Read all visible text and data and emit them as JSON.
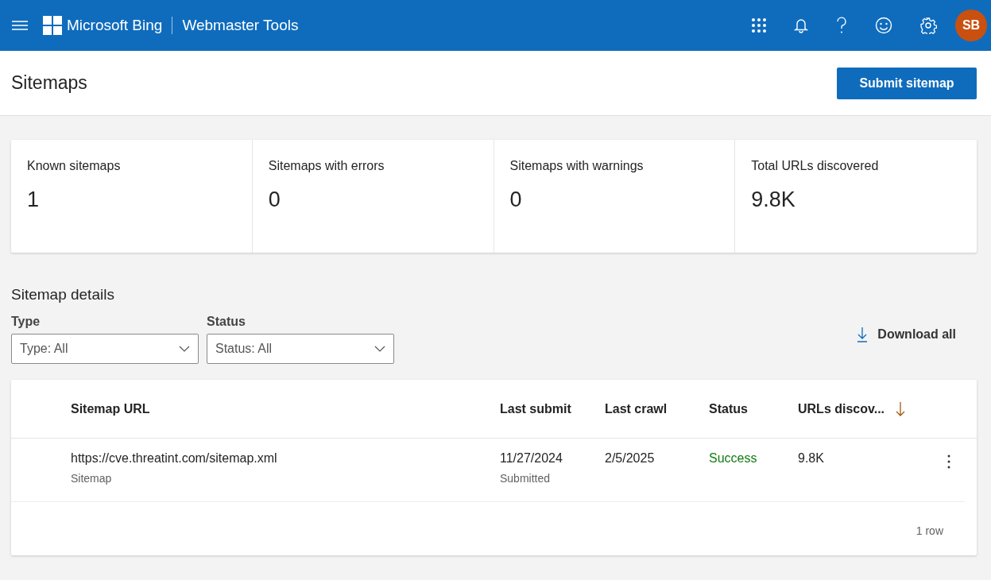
{
  "header": {
    "brand": "Microsoft Bing",
    "product": "Webmaster Tools",
    "avatar": "SB"
  },
  "page": {
    "title": "Sitemaps",
    "primary_action": "Submit sitemap"
  },
  "stats": [
    {
      "label": "Known sitemaps",
      "value": "1"
    },
    {
      "label": "Sitemaps with errors",
      "value": "0"
    },
    {
      "label": "Sitemaps with warnings",
      "value": "0"
    },
    {
      "label": "Total URLs discovered",
      "value": "9.8K"
    }
  ],
  "details": {
    "title": "Sitemap details",
    "filters": [
      {
        "label": "Type",
        "value": "Type: All"
      },
      {
        "label": "Status",
        "value": "Status: All"
      }
    ],
    "download": "Download all"
  },
  "table": {
    "columns": [
      {
        "label": "Sitemap URL",
        "sorted": false
      },
      {
        "label": "Last submit",
        "sorted": false
      },
      {
        "label": "Last crawl",
        "sorted": false
      },
      {
        "label": "Status",
        "sorted": false
      },
      {
        "label": "URLs discov...",
        "sorted": true
      }
    ],
    "rows": [
      {
        "url": "https://cve.threatint.com/sitemap.xml",
        "type": "Sitemap",
        "last_submit": "11/27/2024",
        "submit_note": "Submitted",
        "last_crawl": "2/5/2025",
        "status": "Success",
        "kind": "success",
        "urls": "9.8K"
      }
    ],
    "footer": "1 row"
  }
}
